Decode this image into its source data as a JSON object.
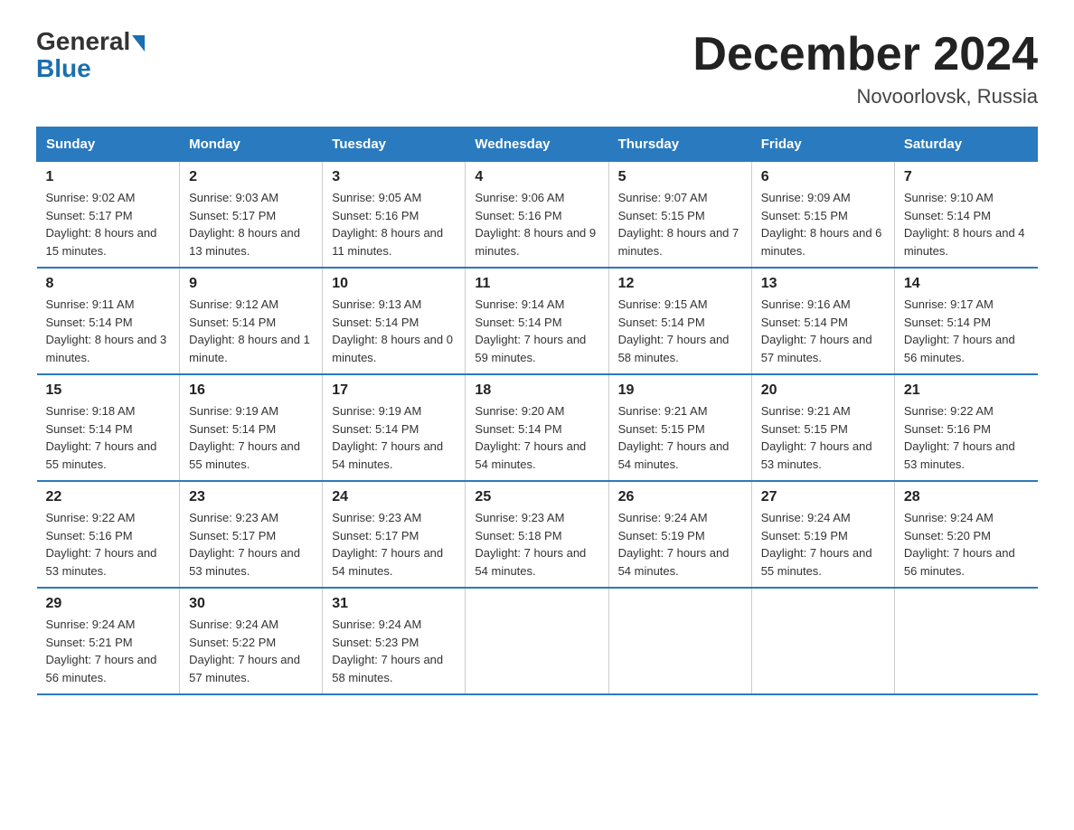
{
  "logo": {
    "general": "General",
    "blue": "Blue"
  },
  "header": {
    "title": "December 2024",
    "location": "Novoorlovsk, Russia"
  },
  "days_of_week": [
    "Sunday",
    "Monday",
    "Tuesday",
    "Wednesday",
    "Thursday",
    "Friday",
    "Saturday"
  ],
  "weeks": [
    [
      {
        "day": "1",
        "sunrise": "9:02 AM",
        "sunset": "5:17 PM",
        "daylight": "8 hours and 15 minutes."
      },
      {
        "day": "2",
        "sunrise": "9:03 AM",
        "sunset": "5:17 PM",
        "daylight": "8 hours and 13 minutes."
      },
      {
        "day": "3",
        "sunrise": "9:05 AM",
        "sunset": "5:16 PM",
        "daylight": "8 hours and 11 minutes."
      },
      {
        "day": "4",
        "sunrise": "9:06 AM",
        "sunset": "5:16 PM",
        "daylight": "8 hours and 9 minutes."
      },
      {
        "day": "5",
        "sunrise": "9:07 AM",
        "sunset": "5:15 PM",
        "daylight": "8 hours and 7 minutes."
      },
      {
        "day": "6",
        "sunrise": "9:09 AM",
        "sunset": "5:15 PM",
        "daylight": "8 hours and 6 minutes."
      },
      {
        "day": "7",
        "sunrise": "9:10 AM",
        "sunset": "5:14 PM",
        "daylight": "8 hours and 4 minutes."
      }
    ],
    [
      {
        "day": "8",
        "sunrise": "9:11 AM",
        "sunset": "5:14 PM",
        "daylight": "8 hours and 3 minutes."
      },
      {
        "day": "9",
        "sunrise": "9:12 AM",
        "sunset": "5:14 PM",
        "daylight": "8 hours and 1 minute."
      },
      {
        "day": "10",
        "sunrise": "9:13 AM",
        "sunset": "5:14 PM",
        "daylight": "8 hours and 0 minutes."
      },
      {
        "day": "11",
        "sunrise": "9:14 AM",
        "sunset": "5:14 PM",
        "daylight": "7 hours and 59 minutes."
      },
      {
        "day": "12",
        "sunrise": "9:15 AM",
        "sunset": "5:14 PM",
        "daylight": "7 hours and 58 minutes."
      },
      {
        "day": "13",
        "sunrise": "9:16 AM",
        "sunset": "5:14 PM",
        "daylight": "7 hours and 57 minutes."
      },
      {
        "day": "14",
        "sunrise": "9:17 AM",
        "sunset": "5:14 PM",
        "daylight": "7 hours and 56 minutes."
      }
    ],
    [
      {
        "day": "15",
        "sunrise": "9:18 AM",
        "sunset": "5:14 PM",
        "daylight": "7 hours and 55 minutes."
      },
      {
        "day": "16",
        "sunrise": "9:19 AM",
        "sunset": "5:14 PM",
        "daylight": "7 hours and 55 minutes."
      },
      {
        "day": "17",
        "sunrise": "9:19 AM",
        "sunset": "5:14 PM",
        "daylight": "7 hours and 54 minutes."
      },
      {
        "day": "18",
        "sunrise": "9:20 AM",
        "sunset": "5:14 PM",
        "daylight": "7 hours and 54 minutes."
      },
      {
        "day": "19",
        "sunrise": "9:21 AM",
        "sunset": "5:15 PM",
        "daylight": "7 hours and 54 minutes."
      },
      {
        "day": "20",
        "sunrise": "9:21 AM",
        "sunset": "5:15 PM",
        "daylight": "7 hours and 53 minutes."
      },
      {
        "day": "21",
        "sunrise": "9:22 AM",
        "sunset": "5:16 PM",
        "daylight": "7 hours and 53 minutes."
      }
    ],
    [
      {
        "day": "22",
        "sunrise": "9:22 AM",
        "sunset": "5:16 PM",
        "daylight": "7 hours and 53 minutes."
      },
      {
        "day": "23",
        "sunrise": "9:23 AM",
        "sunset": "5:17 PM",
        "daylight": "7 hours and 53 minutes."
      },
      {
        "day": "24",
        "sunrise": "9:23 AM",
        "sunset": "5:17 PM",
        "daylight": "7 hours and 54 minutes."
      },
      {
        "day": "25",
        "sunrise": "9:23 AM",
        "sunset": "5:18 PM",
        "daylight": "7 hours and 54 minutes."
      },
      {
        "day": "26",
        "sunrise": "9:24 AM",
        "sunset": "5:19 PM",
        "daylight": "7 hours and 54 minutes."
      },
      {
        "day": "27",
        "sunrise": "9:24 AM",
        "sunset": "5:19 PM",
        "daylight": "7 hours and 55 minutes."
      },
      {
        "day": "28",
        "sunrise": "9:24 AM",
        "sunset": "5:20 PM",
        "daylight": "7 hours and 56 minutes."
      }
    ],
    [
      {
        "day": "29",
        "sunrise": "9:24 AM",
        "sunset": "5:21 PM",
        "daylight": "7 hours and 56 minutes."
      },
      {
        "day": "30",
        "sunrise": "9:24 AM",
        "sunset": "5:22 PM",
        "daylight": "7 hours and 57 minutes."
      },
      {
        "day": "31",
        "sunrise": "9:24 AM",
        "sunset": "5:23 PM",
        "daylight": "7 hours and 58 minutes."
      },
      null,
      null,
      null,
      null
    ]
  ]
}
